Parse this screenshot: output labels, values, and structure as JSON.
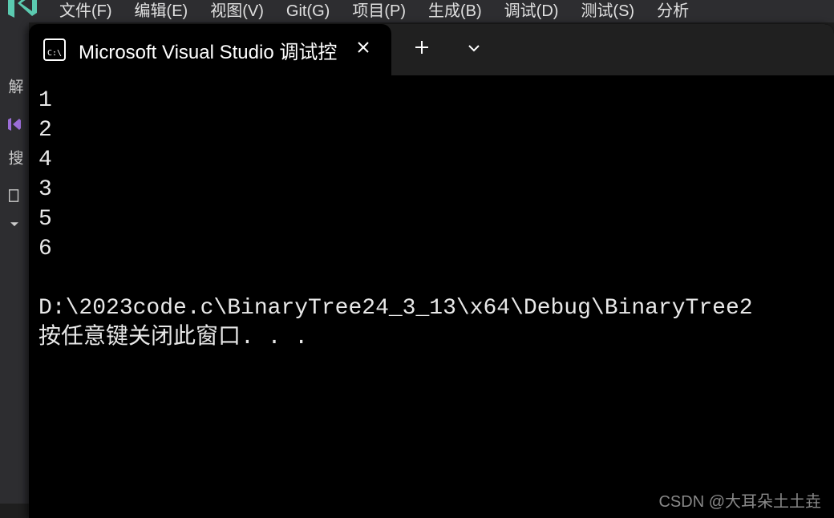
{
  "menu": {
    "items": [
      "文件(F)",
      "编辑(E)",
      "视图(V)",
      "Git(G)",
      "项目(P)",
      "生成(B)",
      "调试(D)",
      "测试(S)",
      "分析"
    ]
  },
  "sidebar": {
    "label1": "解",
    "label2": "搜"
  },
  "terminal": {
    "tab_title": "Microsoft Visual Studio 调试控",
    "output_lines": [
      "1",
      "2",
      "4",
      "3",
      "5",
      "6",
      "",
      "D:\\2023code.c\\BinaryTree24_3_13\\x64\\Debug\\BinaryTree2",
      "按任意键关闭此窗口. . ."
    ]
  },
  "watermark": "CSDN @大耳朵土土垚"
}
